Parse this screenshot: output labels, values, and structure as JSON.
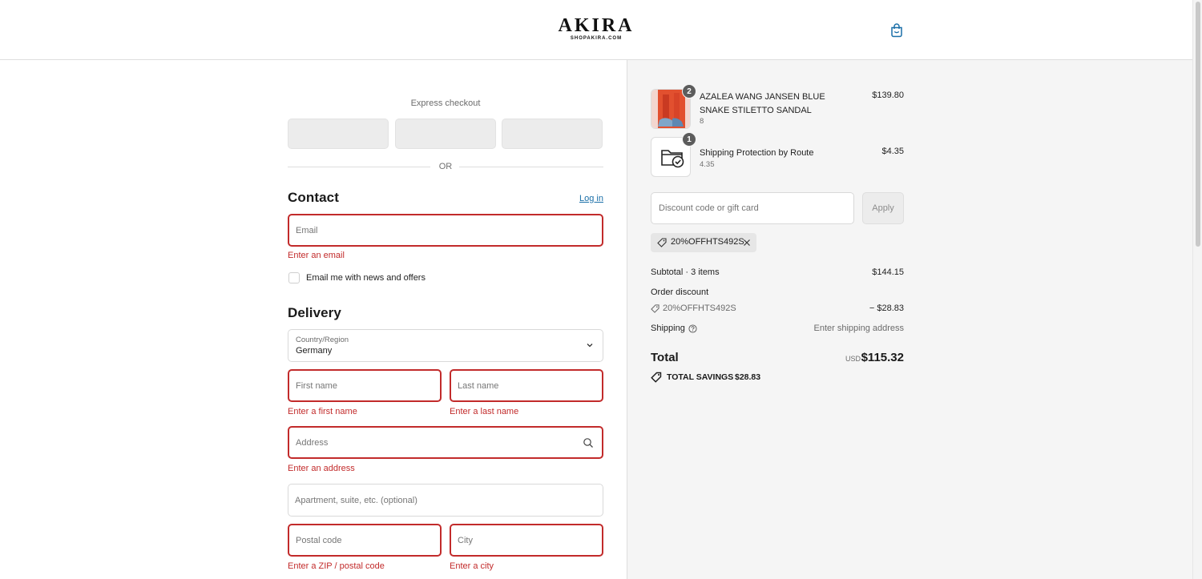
{
  "header": {
    "logo_main": "AKIRA",
    "logo_sub": "SHOPAKIRA.COM",
    "cart_icon": "shopping-bag-icon"
  },
  "express": {
    "title": "Express checkout",
    "or_label": "OR"
  },
  "contact": {
    "title": "Contact",
    "login_label": "Log in",
    "email_placeholder": "Email",
    "email_error": "Enter an email",
    "newsletter_label": "Email me with news and offers",
    "newsletter_checked": false
  },
  "delivery": {
    "title": "Delivery",
    "country_label": "Country/Region",
    "country_value": "Germany",
    "first_name_placeholder": "First name",
    "first_name_error": "Enter a first name",
    "last_name_placeholder": "Last name",
    "last_name_error": "Enter a last name",
    "address_placeholder": "Address",
    "address_error": "Enter an address",
    "apartment_placeholder": "Apartment, suite, etc. (optional)",
    "postal_placeholder": "Postal code",
    "postal_error": "Enter a ZIP / postal code",
    "city_placeholder": "City",
    "city_error": "Enter a city"
  },
  "summary": {
    "items": [
      {
        "name": "AZALEA WANG JANSEN BLUE SNAKE STILETTO SANDAL",
        "variant": "8",
        "qty": "2",
        "price": "$139.80"
      },
      {
        "name": "Shipping Protection by Route",
        "variant": "4.35",
        "qty": "1",
        "price": "$4.35"
      }
    ],
    "discount_placeholder": "Discount code or gift card",
    "apply_label": "Apply",
    "applied_code": "20%OFFHTS492S",
    "subtotal_label": "Subtotal · 3 items",
    "subtotal_value": "$144.15",
    "order_discount_label": "Order discount",
    "discount_code": "20%OFFHTS492S",
    "discount_value": "− $28.83",
    "shipping_label": "Shipping",
    "shipping_value": "Enter shipping address",
    "total_label": "Total",
    "currency": "USD",
    "total_value": "$115.32",
    "savings_label": "TOTAL SAVINGS",
    "savings_value": "$28.83"
  },
  "colors": {
    "error": "#c22b2b",
    "link": "#1a6fa8",
    "summary_bg": "#f5f5f5"
  }
}
